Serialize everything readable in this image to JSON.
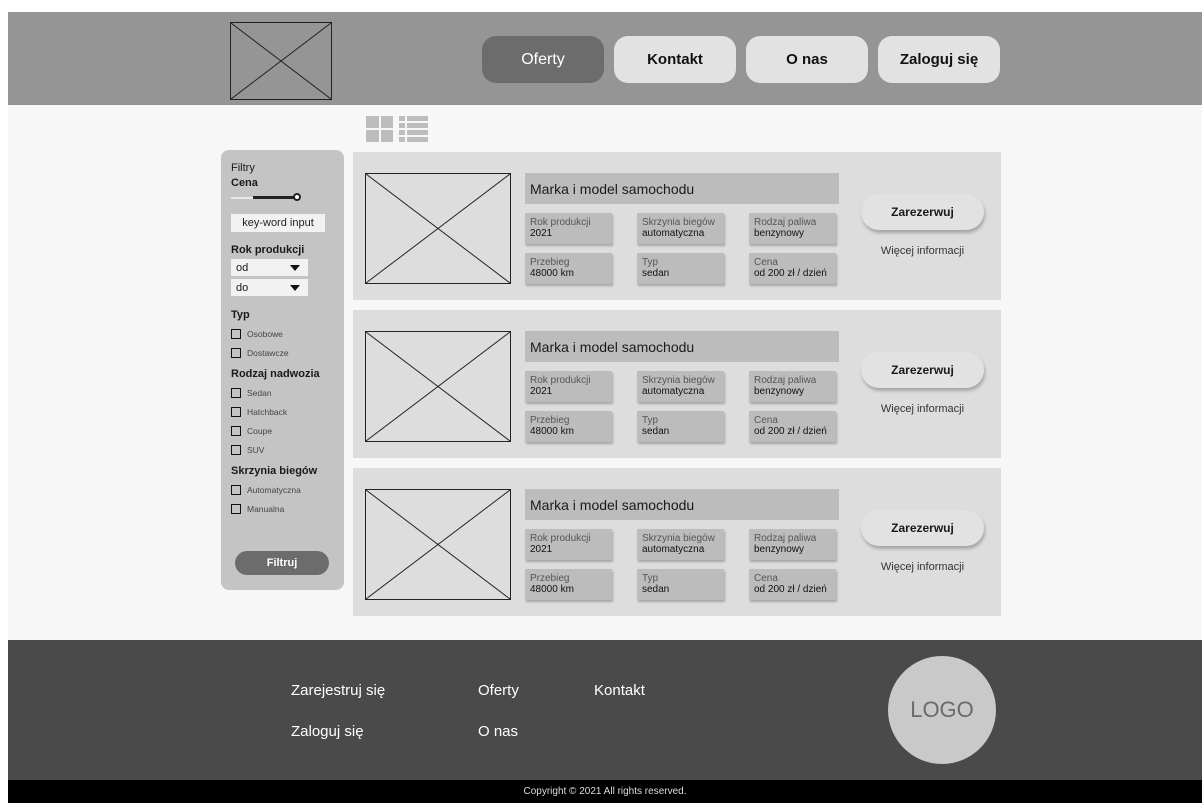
{
  "header": {
    "nav": [
      {
        "label": "Oferty",
        "active": true
      },
      {
        "label": "Kontakt",
        "active": false
      },
      {
        "label": "O nas",
        "active": false
      },
      {
        "label": "Zaloguj się",
        "active": false
      }
    ]
  },
  "view_icons": [
    "grid-view-icon",
    "list-view-icon"
  ],
  "filters": {
    "title": "Filtry",
    "price_heading": "Cena",
    "keyword_input": {
      "value": "key-word input"
    },
    "year_heading": "Rok produkcji",
    "year_from": "od",
    "year_to": "do",
    "type_heading": "Typ",
    "type_options": [
      "Osobowe",
      "Dostawcze"
    ],
    "body_heading": "Rodzaj nadwozia",
    "body_options": [
      "Sedan",
      "Hatchback",
      "Coupe",
      "SUV"
    ],
    "gearbox_heading": "Skrzynia biegów",
    "gearbox_options": [
      "Automatyczna",
      "Manualna"
    ],
    "submit_label": "Filtruj"
  },
  "cards": [
    {
      "model": "Marka i model samochodu",
      "year_label": "Rok produkcji",
      "year": "2021",
      "gearbox_label": "Skrzynia biegów",
      "gearbox": "automatyczna",
      "fuel_label": "Rodzaj paliwa",
      "fuel": "benzynowy",
      "mileage_label": "Przebieg",
      "mileage": "48000 km",
      "type_label": "Typ",
      "type": "sedan",
      "price_label": "Cena",
      "price": "od 200 zł / dzień",
      "reserve_label": "Zarezerwuj",
      "more_label": "Więcej informacji"
    },
    {
      "model": "Marka i model samochodu",
      "year_label": "Rok produkcji",
      "year": "2021",
      "gearbox_label": "Skrzynia biegów",
      "gearbox": "automatyczna",
      "fuel_label": "Rodzaj paliwa",
      "fuel": "benzynowy",
      "mileage_label": "Przebieg",
      "mileage": "48000 km",
      "type_label": "Typ",
      "type": "sedan",
      "price_label": "Cena",
      "price": "od 200 zł / dzień",
      "reserve_label": "Zarezerwuj",
      "more_label": "Więcej informacji"
    },
    {
      "model": "Marka i model samochodu",
      "year_label": "Rok produkcji",
      "year": "2021",
      "gearbox_label": "Skrzynia biegów",
      "gearbox": "automatyczna",
      "fuel_label": "Rodzaj paliwa",
      "fuel": "benzynowy",
      "mileage_label": "Przebieg",
      "mileage": "48000 km",
      "type_label": "Typ",
      "type": "sedan",
      "price_label": "Cena",
      "price": "od 200 zł / dzień",
      "reserve_label": "Zarezerwuj",
      "more_label": "Więcej informacji"
    }
  ],
  "footer": {
    "links": [
      "Zarejestruj się",
      "Oferty",
      "Kontakt",
      "Zaloguj się",
      "O nas"
    ],
    "logo_text": "LOGO",
    "copyright": "Copyright © 2021 All rights reserved."
  }
}
